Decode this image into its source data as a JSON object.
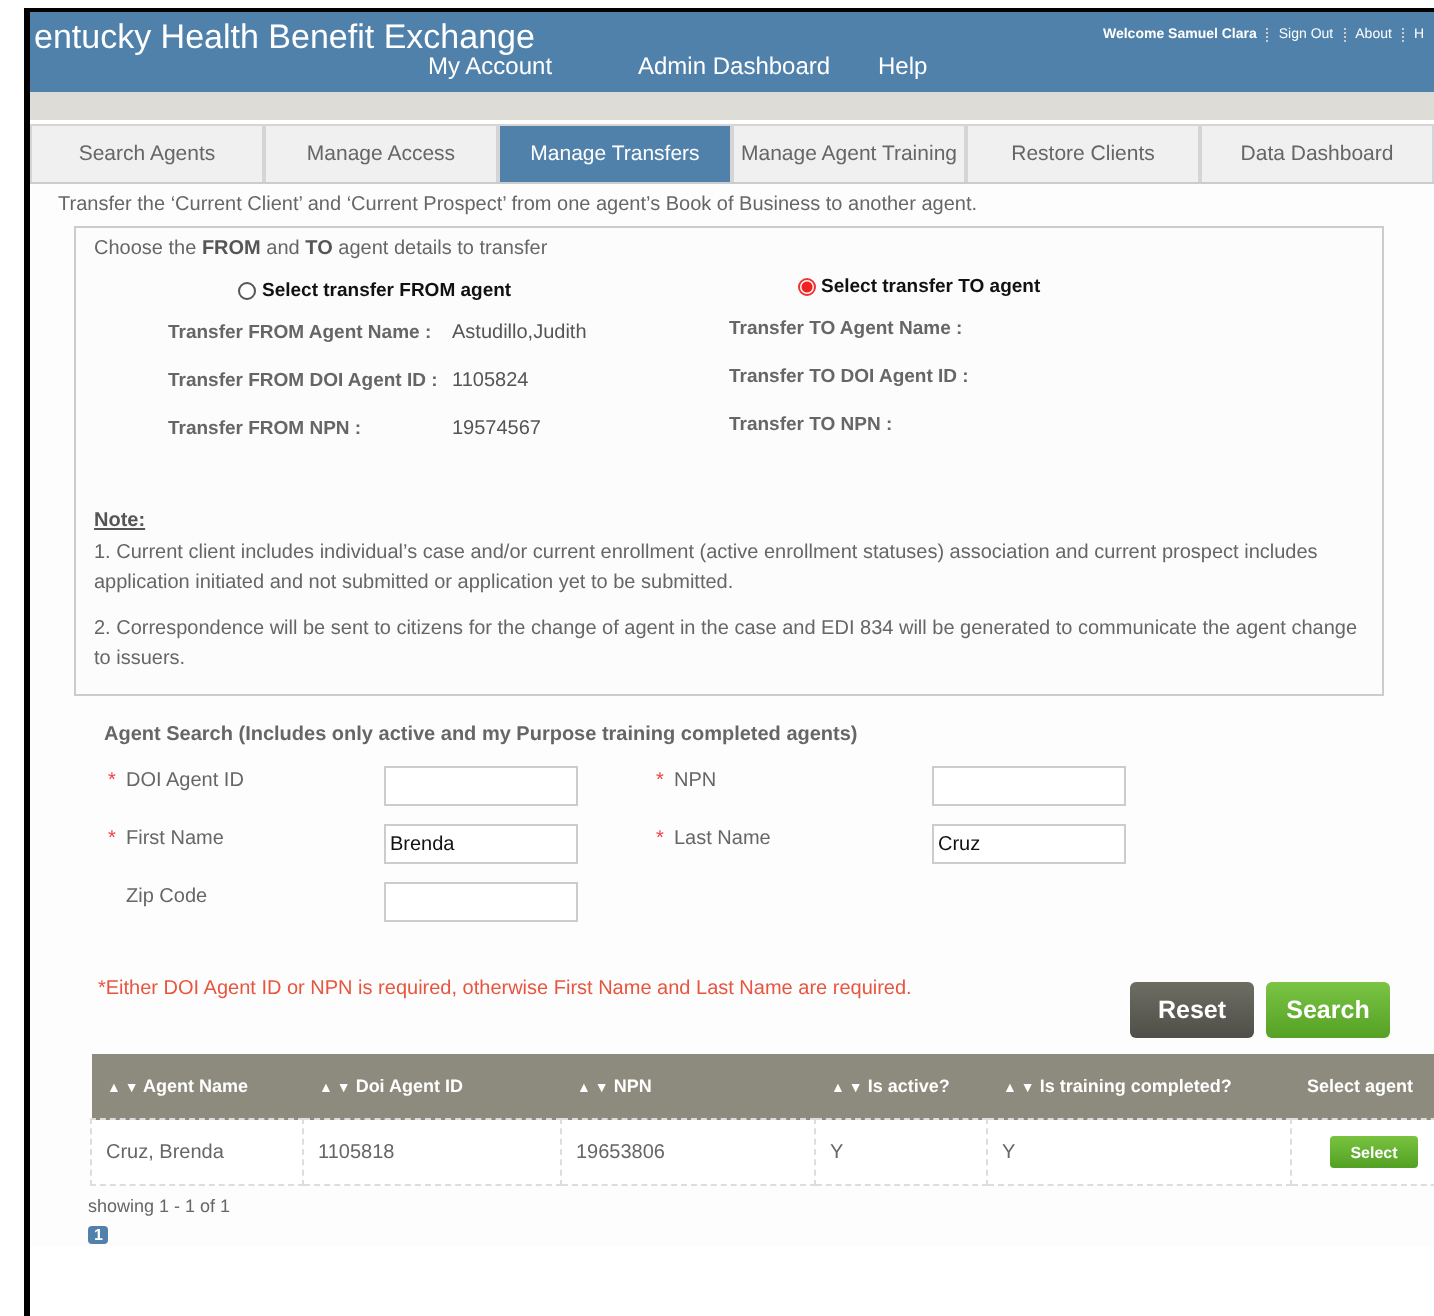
{
  "header": {
    "title": "entucky Health Benefit Exchange",
    "nav": [
      "My Account",
      "Admin Dashboard",
      "Help"
    ],
    "welcome": "Welcome Samuel Clara",
    "links": [
      "Sign Out",
      "About",
      "H"
    ]
  },
  "tabs": [
    {
      "label": "Search Agents",
      "selected": false
    },
    {
      "label": "Manage Access",
      "selected": false
    },
    {
      "label": "Manage Transfers",
      "selected": true
    },
    {
      "label": "Manage Agent Training",
      "selected": false
    },
    {
      "label": "Restore Clients",
      "selected": false
    },
    {
      "label": "Data Dashboard",
      "selected": false
    }
  ],
  "intro": "Transfer the ‘Current Client’ and ‘Current Prospect’ from one agent’s Book of Business to another agent.",
  "transfer": {
    "heading": "Choose the **FROM** and **TO** agent details to transfer",
    "sides": [
      {
        "radio": "Select transfer FROM agent",
        "selected": false,
        "fields": [
          {
            "label": "Transfer FROM Agent Name :",
            "value": "Astudillo,Judith"
          },
          {
            "label": "Transfer FROM DOI Agent ID :",
            "value": "1105824"
          },
          {
            "label": "Transfer FROM NPN :",
            "value": "19574567"
          }
        ]
      },
      {
        "radio": "Select transfer TO agent",
        "selected": true,
        "fields": [
          {
            "label": "Transfer TO Agent Name :"
          },
          {
            "label": "Transfer TO DOI Agent ID :"
          },
          {
            "label": "Transfer TO NPN :"
          }
        ]
      }
    ],
    "note_title": "Note:",
    "notes": [
      "1. Current client includes individual’s case and/or current enrollment (active enrollment statuses) association and current prospect includes application initiated and not submitted or application yet to be submitted.",
      "2. Correspondence will be sent to citizens for the change of agent in the case and EDI 834 will be generated to communicate the agent change to issuers."
    ]
  },
  "search": {
    "title": "Agent Search (Includes only active and my Purpose training completed agents)",
    "fields": [
      {
        "label": "DOI Agent ID",
        "required": true
      },
      {
        "label": "NPN",
        "required": true
      },
      {
        "label": "First Name",
        "required": true,
        "value": "Brenda"
      },
      {
        "label": "Last Name",
        "required": true,
        "value": "Cruz"
      },
      {
        "label": "Zip Code",
        "required": false
      }
    ],
    "required_mark": "*",
    "hint": "*Either DOI Agent ID or NPN is required, otherwise First Name and Last Name are required.",
    "buttons": [
      "Reset",
      "Search"
    ]
  },
  "table": {
    "columns": [
      {
        "label": "Agent Name",
        "sort": "▲ ▼"
      },
      {
        "label": "Doi Agent ID",
        "sort": "▲ ▼"
      },
      {
        "label": "NPN",
        "sort": "▲ ▼"
      },
      {
        "label": "Is active?",
        "sort": "▲ ▼"
      },
      {
        "label": "Is training completed?",
        "sort": "▲ ▼"
      },
      {
        "label": "Select agent"
      }
    ],
    "rows": [
      {
        "cells": [
          "Cruz, Brenda",
          "1105818",
          "19653806",
          "Y",
          "Y"
        ],
        "button": "Select"
      }
    ],
    "showing": "showing 1  - 1  of 1",
    "pages": [
      {
        "label": "1",
        "selected": true
      }
    ]
  }
}
